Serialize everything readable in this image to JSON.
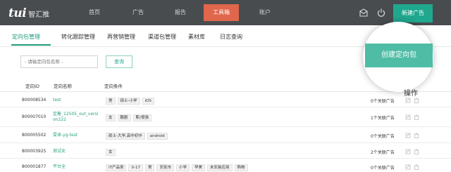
{
  "header": {
    "logo": "tui",
    "brand": "智汇推",
    "nav": [
      "首页",
      "广告",
      "报告",
      "工具箱",
      "账户"
    ],
    "active_nav": "工具箱",
    "new_ad": "新建广告"
  },
  "tabs": [
    "定向包管理",
    "转化跟踪管理",
    "再营销管理",
    "渠道包管理",
    "素材库",
    "日志查询"
  ],
  "search": {
    "placeholder": "- 请输定向包名称 -",
    "button": "查询"
  },
  "create_button": "创建定向包",
  "table": {
    "headers": [
      "定向ID",
      "定向名称",
      "定向条件",
      "操作"
    ],
    "rows": [
      {
        "id": "800008534",
        "name": "test",
        "conditions": [
          "男",
          "硕士-小学",
          "iOS"
        ],
        "status": "0个关联广告"
      },
      {
        "id": "800007010",
        "name": "定着_12505_out_version222",
        "conditions": [
          "女",
          "鹏剧",
          "斯/很强"
        ],
        "status": "1个关联广告"
      },
      {
        "id": "800005502",
        "name": "雯卓-yg-test",
        "conditions": [
          "硕士-大学,高中初中",
          "android"
        ],
        "status": "0个关联广告"
      },
      {
        "id": "800003925",
        "name": "测试女",
        "conditions": [
          "女"
        ],
        "status": "2个关联广告"
      },
      {
        "id": "800001877",
        "name": "平台全",
        "conditions": [
          "IT产品类",
          "0-17",
          "男",
          "安抚市",
          "小学",
          "早美",
          "未安装应用",
          "购物"
        ],
        "status": "0个关联广告"
      }
    ]
  }
}
